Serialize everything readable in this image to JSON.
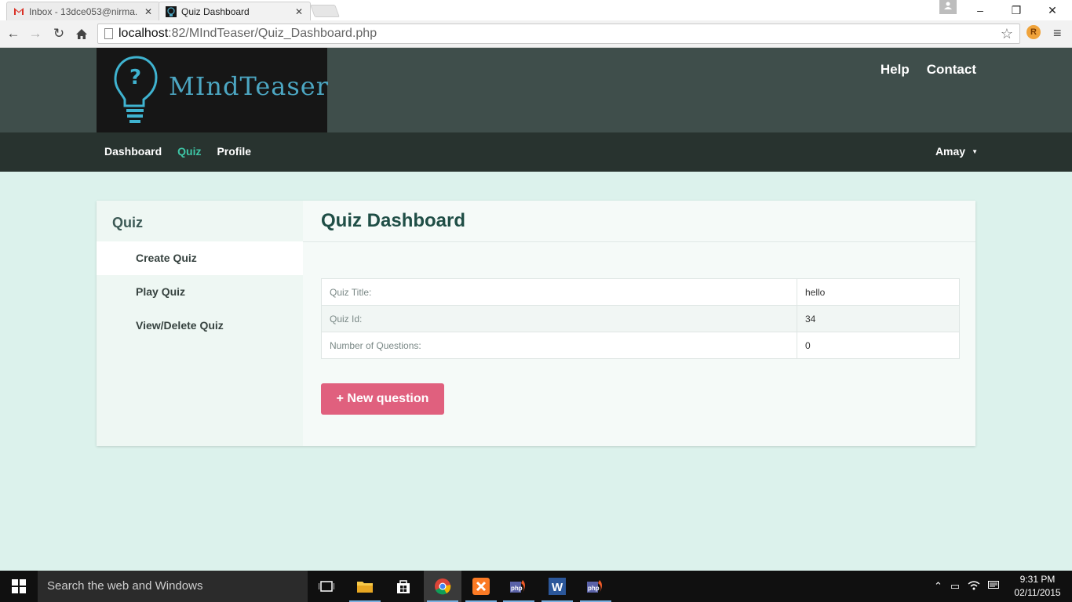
{
  "browser": {
    "tabs": [
      {
        "title": "Inbox - 13dce053@nirma.",
        "active": false
      },
      {
        "title": "Quiz Dashboard",
        "active": true
      }
    ],
    "url_host": "localhost",
    "url_path": ":82/MIndTeaser/Quiz_Dashboard.php"
  },
  "site": {
    "logo_text": "MIndTeaser",
    "top_links": [
      "Help",
      "Contact"
    ],
    "nav": [
      {
        "label": "Dashboard",
        "active": false
      },
      {
        "label": "Quiz",
        "active": true
      },
      {
        "label": "Profile",
        "active": false
      }
    ],
    "user": "Amay"
  },
  "sidebar": {
    "title": "Quiz",
    "items": [
      {
        "label": "Create Quiz",
        "selected": true
      },
      {
        "label": "Play Quiz",
        "selected": false
      },
      {
        "label": "View/Delete Quiz",
        "selected": false
      }
    ]
  },
  "main": {
    "title": "Quiz Dashboard",
    "rows": [
      {
        "label": "Quiz Title:",
        "value": "hello"
      },
      {
        "label": "Quiz Id:",
        "value": "34"
      },
      {
        "label": "Number of Questions:",
        "value": "0"
      }
    ],
    "new_question_label": "+ New question"
  },
  "taskbar": {
    "search_placeholder": "Search the web and Windows",
    "time": "9:31 PM",
    "date": "02/11/2015"
  },
  "colors": {
    "header": "#3f4e4b",
    "nav": "#28332f",
    "accent": "#3ec6a6",
    "page_bg": "#dcf2ec",
    "button": "#e0607e"
  }
}
